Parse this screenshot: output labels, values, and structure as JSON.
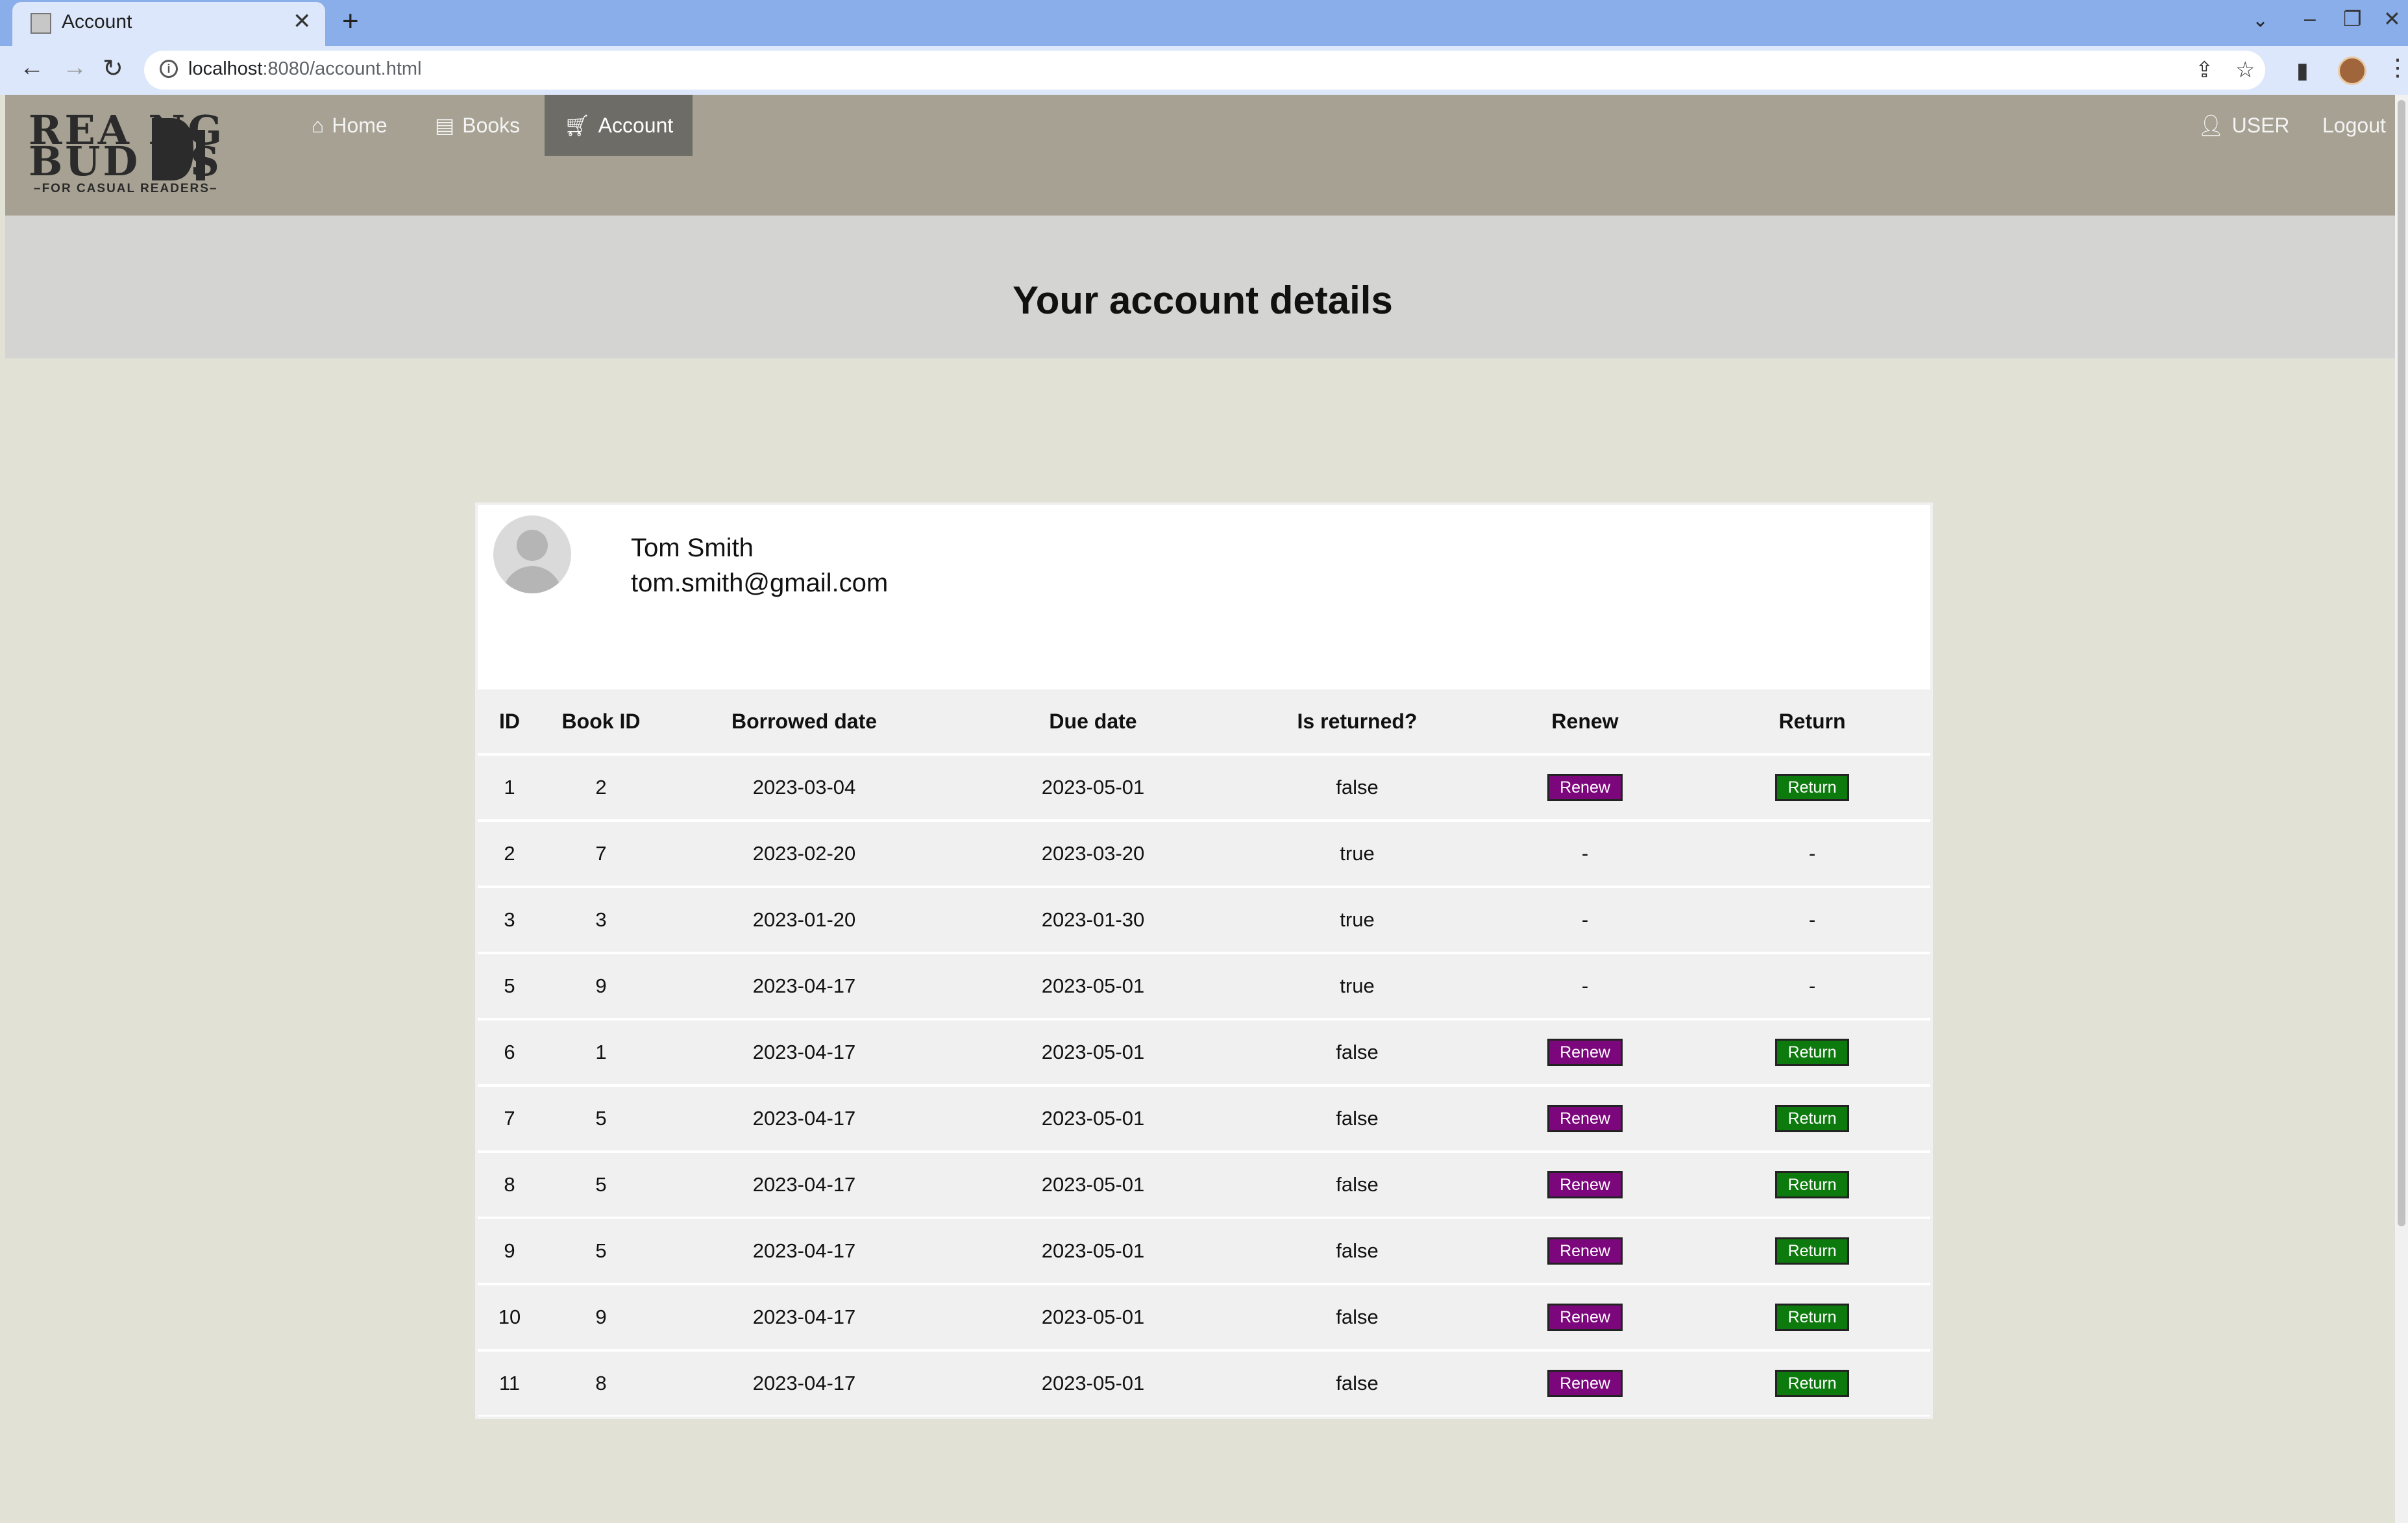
{
  "browser": {
    "tab_title": "Account",
    "url_host": "localhost",
    "url_rest": ":8080/account.html"
  },
  "nav": {
    "logo_line1": "REA NG",
    "logo_line2": "BUD ES",
    "logo_tagline": "–FOR CASUAL READERS–",
    "home": "Home",
    "books": "Books",
    "account": "Account",
    "user": "USER",
    "logout": "Logout"
  },
  "page": {
    "title": "Your account details"
  },
  "user": {
    "name": "Tom Smith",
    "email": "tom.smith@gmail.com"
  },
  "table": {
    "headers": [
      "ID",
      "Book ID",
      "Borrowed date",
      "Due date",
      "Is returned?",
      "Renew",
      "Return"
    ],
    "rows": [
      {
        "id": "1",
        "book_id": "2",
        "borrowed": "2023-03-04",
        "due": "2023-05-01",
        "returned": "false",
        "renew": "Renew",
        "return": "Return"
      },
      {
        "id": "2",
        "book_id": "7",
        "borrowed": "2023-02-20",
        "due": "2023-03-20",
        "returned": "true",
        "renew": "-",
        "return": "-"
      },
      {
        "id": "3",
        "book_id": "3",
        "borrowed": "2023-01-20",
        "due": "2023-01-30",
        "returned": "true",
        "renew": "-",
        "return": "-"
      },
      {
        "id": "5",
        "book_id": "9",
        "borrowed": "2023-04-17",
        "due": "2023-05-01",
        "returned": "true",
        "renew": "-",
        "return": "-"
      },
      {
        "id": "6",
        "book_id": "1",
        "borrowed": "2023-04-17",
        "due": "2023-05-01",
        "returned": "false",
        "renew": "Renew",
        "return": "Return"
      },
      {
        "id": "7",
        "book_id": "5",
        "borrowed": "2023-04-17",
        "due": "2023-05-01",
        "returned": "false",
        "renew": "Renew",
        "return": "Return"
      },
      {
        "id": "8",
        "book_id": "5",
        "borrowed": "2023-04-17",
        "due": "2023-05-01",
        "returned": "false",
        "renew": "Renew",
        "return": "Return"
      },
      {
        "id": "9",
        "book_id": "5",
        "borrowed": "2023-04-17",
        "due": "2023-05-01",
        "returned": "false",
        "renew": "Renew",
        "return": "Return"
      },
      {
        "id": "10",
        "book_id": "9",
        "borrowed": "2023-04-17",
        "due": "2023-05-01",
        "returned": "false",
        "renew": "Renew",
        "return": "Return"
      },
      {
        "id": "11",
        "book_id": "8",
        "borrowed": "2023-04-17",
        "due": "2023-05-01",
        "returned": "false",
        "renew": "Renew",
        "return": "Return"
      }
    ]
  },
  "colors": {
    "renew_button": "#7c067c",
    "return_button": "#0d7a0d",
    "navbar": "#a6a193",
    "page_background": "#e1e1d6"
  }
}
